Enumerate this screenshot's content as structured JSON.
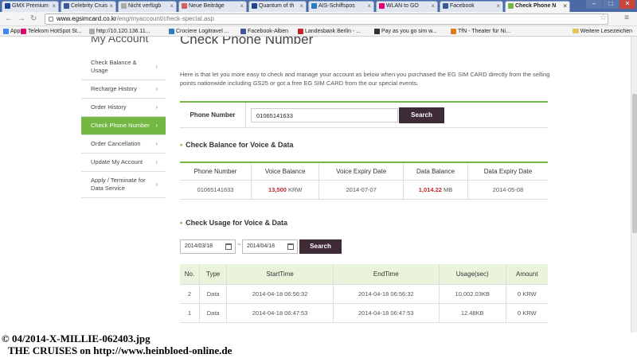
{
  "browser": {
    "tabs": [
      {
        "label": "GMX Premium",
        "color": "#1c449b"
      },
      {
        "label": "Celebrity Cruis",
        "color": "#3b5998"
      },
      {
        "label": "Nicht verfügb",
        "color": "#aaaaaa"
      },
      {
        "label": "Neue Beiträge",
        "color": "#d35f5f"
      },
      {
        "label": "Quantum of th",
        "color": "#224488"
      },
      {
        "label": "AIS-Schiffspos",
        "color": "#2a7bc0"
      },
      {
        "label": "WLAN to GO",
        "color": "#e20074"
      },
      {
        "label": "Facebook",
        "color": "#3b5998"
      },
      {
        "label": "Check Phone N",
        "color": "#72b843"
      }
    ],
    "active_tab_index": 8,
    "url_host": "www.egsimcard.co.kr",
    "url_path": "/eng/myaccount/check-special.asp",
    "bookmarks": [
      {
        "label": "Apps",
        "color": "#4285f4"
      },
      {
        "label": "Telekom HotSpot St...",
        "color": "#e20074"
      },
      {
        "label": "http://10.120.136.11...",
        "color": "#aaaaaa"
      },
      {
        "label": "Crociere Logitravel ...",
        "color": "#2a7bc0"
      },
      {
        "label": "Facebook-Alben",
        "color": "#3b5998"
      },
      {
        "label": "Landesbank Berlin - ...",
        "color": "#c0272d"
      },
      {
        "label": "Pay as you go sim w...",
        "color": "#333333"
      },
      {
        "label": "TfN - Theater für Ni...",
        "color": "#e07a1c"
      }
    ],
    "bookmarks_folder": "Weitere Lesezeichen"
  },
  "sidebar": {
    "title": "My Account",
    "items": [
      {
        "label": "Check Balance & Usage",
        "active": false
      },
      {
        "label": "Recharge History",
        "active": false
      },
      {
        "label": "Order History",
        "active": false
      },
      {
        "label": "Check Phone Number",
        "active": true
      },
      {
        "label": "Order Cancellation",
        "active": false
      },
      {
        "label": "Update My Account",
        "active": false
      },
      {
        "label": "Apply / Terminate for Data Service",
        "active": false
      }
    ]
  },
  "main": {
    "title": "Check Phone Number",
    "intro": "Here is that let you more easy to check and manage your account as below when you purchased the EG SIM CARD directly from the selling points nationwide including GS25 or got a free EG SIM CARD from the our special events.",
    "phone_label": "Phone Number",
    "phone_value": "01065141633",
    "search_label": "Search",
    "balance_title": "Check Balance for Voice & Data",
    "balance_headers": [
      "Phone Number",
      "Voice Balance",
      "Voice Expiry Date",
      "Data Balance",
      "Data Expiry Date"
    ],
    "balance_row": {
      "phone": "01065141633",
      "voice_amount": "13,500",
      "voice_unit": " KRW",
      "voice_expiry": "2014-07-07",
      "data_amount": "1,014.22",
      "data_unit": " MB",
      "data_expiry": "2014-05-08"
    },
    "usage_title": "Check Usage for Voice & Data",
    "date_from": "2014/03/18",
    "date_to": "2014/04/18",
    "date_separator": "~",
    "usage_headers": [
      "No.",
      "Type",
      "StartTime",
      "EndTime",
      "Usage(sec)",
      "Amount"
    ],
    "usage_rows": [
      [
        "2",
        "Data",
        "2014-04-18 06:56:32",
        "2014-04-18 06:56:32",
        "10,002.03KB",
        "0 KRW"
      ],
      [
        "1",
        "Data",
        "2014-04-18 06:47:53",
        "2014-04-18 06:47:53",
        "12.48KB",
        "0 KRW"
      ]
    ]
  },
  "caption": {
    "line1": "© 04/2014-X-MILLIE-062403.jpg",
    "line2": "THE CRUISES on http://www.heinbloed-online.de"
  },
  "colors": {
    "accent": "#72b843",
    "button": "#3f2b36",
    "highlight": "#c0272d"
  }
}
